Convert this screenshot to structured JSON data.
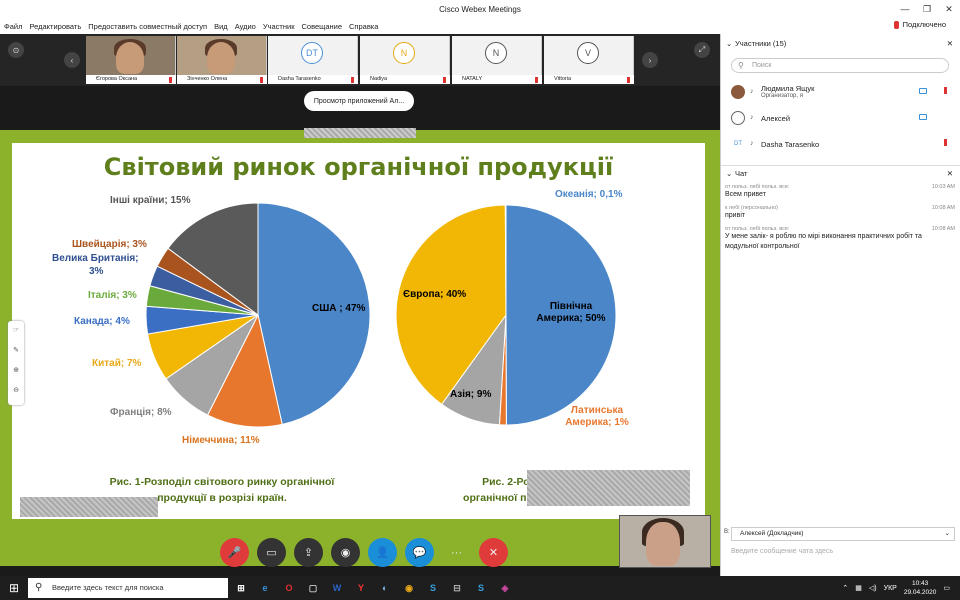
{
  "window": {
    "title": "Cisco Webex Meetings",
    "controls": [
      "—",
      "❐",
      "✕"
    ]
  },
  "menu": [
    "Файл",
    "Редактировать",
    "Предоставить совместный доступ",
    "Вид",
    "Аудио",
    "Участник",
    "Совещание",
    "Справка"
  ],
  "status": {
    "connected": "Подключено"
  },
  "thumbnails": [
    {
      "name": "Єгорова Оксана",
      "type": "photo"
    },
    {
      "name": "Зінченко Олена",
      "type": "photo"
    },
    {
      "name": "Dasha Tarasenko",
      "initials": "DT",
      "color": "#4a90d9"
    },
    {
      "name": "Nadiya",
      "initials": "N",
      "color": "#e8a817"
    },
    {
      "name": "NATALY",
      "initials": "N",
      "color": "#555555"
    },
    {
      "name": "Vittoria",
      "initials": "V",
      "color": "#555555"
    }
  ],
  "app_pill": "Просмотр приложений Ал...",
  "slide": {
    "title": "Світовий ринок органічної продукції",
    "caption1_line1": "Рис. 1-Розподіл світового ринку органічної",
    "caption1_line2": "продукції в розрізі країн.",
    "caption2_line1": "Рис. 2-Розподі",
    "caption2_line2": "органічної продук"
  },
  "chart_data": [
    {
      "type": "pie",
      "categories": [
        "США",
        "Німеччина",
        "Франція",
        "Китай",
        "Канада",
        "Італія",
        "Велика Британія",
        "Швейцарія",
        "Інші країни"
      ],
      "values": [
        47,
        11,
        8,
        7,
        4,
        3,
        3,
        3,
        15
      ],
      "labels": [
        "США ; 47%",
        "Німеччина; 11%",
        "Франція; 8%",
        "Китай; 7%",
        "Канада; 4%",
        "Італія; 3%",
        "Велика Британія;",
        "Швейцарія; 3%",
        "Інші країни; 15%"
      ],
      "label_extra": "3%",
      "colors": [
        "#4a86c8",
        "#e8772e",
        "#a5a5a5",
        "#f2b705",
        "#3a6fc4",
        "#6aaa3c",
        "#3b5ea0",
        "#a9541e",
        "#5a5a5a"
      ],
      "label_colors": [
        "#000000",
        "#d9731e",
        "#7f7f7f",
        "#e8a817",
        "#3a6fc4",
        "#6aaa3c",
        "#2f4f8f",
        "#a9541e",
        "#555555"
      ]
    },
    {
      "type": "pie",
      "categories": [
        "Північна Америка",
        "Латинська Америка",
        "Азія",
        "Європа",
        "Океанія"
      ],
      "values": [
        50,
        1,
        9,
        40,
        0.1
      ],
      "labels": [
        "Північна Америка; 50%",
        "Латинська Америка; 1%",
        "Азія; 9%",
        "Європа; 40%",
        "Океанія; 0,1%"
      ],
      "colors": [
        "#4a86c8",
        "#e8772e",
        "#a5a5a5",
        "#f2b705",
        "#4a86c8"
      ],
      "label_colors": [
        "#000000",
        "#e8772e",
        "#000000",
        "#000000",
        "#4a86c8"
      ]
    }
  ],
  "controls": [
    {
      "name": "mute",
      "glyph": "🎤",
      "style": "red"
    },
    {
      "name": "video",
      "glyph": "▭",
      "style": "dark"
    },
    {
      "name": "share",
      "glyph": "⇪",
      "style": "dark"
    },
    {
      "name": "record",
      "glyph": "◉",
      "style": "dark"
    },
    {
      "name": "participants",
      "glyph": "👤",
      "style": "blue"
    },
    {
      "name": "chat",
      "glyph": "💬",
      "style": "blue"
    },
    {
      "name": "more",
      "glyph": "···",
      "style": "plain"
    },
    {
      "name": "leave",
      "glyph": "✕",
      "style": "red"
    }
  ],
  "participants": {
    "header": "Участники (15)",
    "search_placeholder": "Поиск",
    "list": [
      {
        "name": "Людмила Ящук",
        "role": "Организатор, я",
        "initials": ""
      },
      {
        "name": "Алексей",
        "role": "",
        "initials": ""
      },
      {
        "name": "Dasha Tarasenko",
        "role": "",
        "initials": "DT"
      }
    ]
  },
  "chat": {
    "header": "Чат",
    "messages": [
      {
        "meta": "от польз. лебі польз. все:",
        "time": "10:03 AM",
        "text": "Всем привет"
      },
      {
        "meta": "к лебі (персонально)",
        "time": "10:08 AM",
        "text": "привіт"
      },
      {
        "meta": "от польз. лебі польз. все:",
        "time": "10:08 AM",
        "text": "У мене залік- я роблю по мірі виконання практичних робіт та модульної контрольної"
      }
    ],
    "to_label": "В:",
    "to_value": "Алексей (Докладчик)",
    "input_placeholder": "Введите сообщение чата здесь"
  },
  "taskbar": {
    "search_placeholder": "Введите здесь текст для поиска",
    "icons": [
      "⊞",
      "e",
      "O",
      "▢",
      "W",
      "Y",
      "◐",
      "◉",
      "S",
      "⊟",
      "S",
      "◈"
    ],
    "lang": "УКР",
    "time": "10:43",
    "date": "29.04.2020"
  }
}
